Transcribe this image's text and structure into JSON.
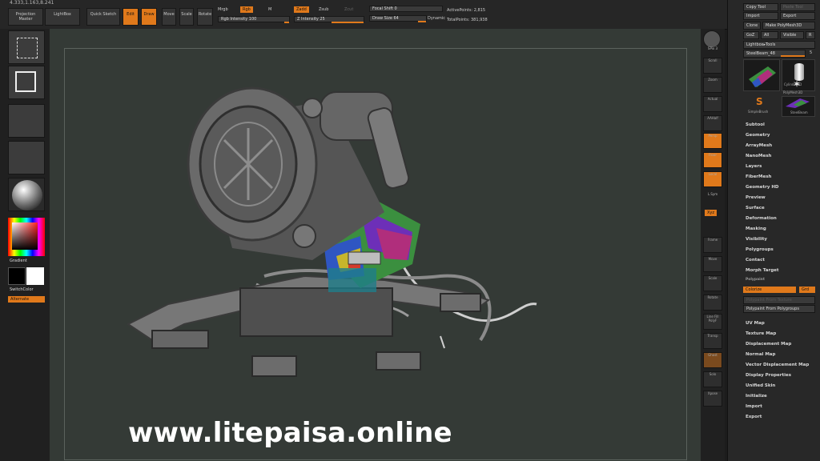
{
  "toolbar": {
    "coords": "4.333,1.163,8.241",
    "projection_master": "Projection Master",
    "lightbox": "LightBox",
    "quick_sketch": "Quick Sketch",
    "edit": "Edit",
    "draw": "Draw",
    "move": "Move",
    "scale": "Scale",
    "rotate": "Rotate",
    "mrgb": "Mrgb",
    "rgb": "Rgb",
    "m": "M",
    "zadd": "Zadd",
    "zsub": "Zsub",
    "zcut": "Zcut",
    "rgb_intensity": "Rgb Intensity 100",
    "z_intensity": "Z Intensity 25",
    "focal_shift": "Focal Shift 0",
    "draw_size": "Draw Size 64",
    "dynamic": "Dynamic",
    "active_points": "ActivePoints: 2,815",
    "total_points": "TotalPoints: 381,938"
  },
  "left_shelf": {
    "gradient": "Gradient",
    "switch_color": "SwitchColor",
    "alternate": "Alternate"
  },
  "right_shelf": {
    "buttons": [
      "BPR",
      "SPix 3",
      "Scroll",
      "Zoom",
      "Actual",
      "AAHalf",
      "Persp",
      "Floor",
      "Local",
      "L.Sym",
      "Frame",
      "Move",
      "Scale",
      "Rotate",
      "Line Fill PolyF",
      "Transp",
      "Ghost",
      "Solo",
      "Xpose"
    ],
    "xyz": "Xyz"
  },
  "tool_panel": {
    "copy_tool": "Copy Tool",
    "paste_tool": "Paste Tool",
    "import": "Import",
    "export": "Export",
    "clone": "Clone",
    "make_polymesh": "Make PolyMesh3D",
    "goz": "GoZ",
    "all": "All",
    "visible": "Visible",
    "r": "R",
    "lightbox_tools": "Lightbox▸Tools",
    "steel_beam": "SteelBeam_48",
    "steel_beam_value": "5",
    "tools": [
      "Cylinder3D",
      "PolyMesh3D",
      "SimpleBrush",
      "SteelBeam"
    ],
    "menu": [
      "Subtool",
      "Geometry",
      "ArrayMesh",
      "NanoMesh",
      "Layers",
      "FiberMesh",
      "Geometry HD",
      "Preview",
      "Surface",
      "Deformation",
      "Masking",
      "Visibility",
      "Polygroups",
      "Contact",
      "Morph Target",
      "Polypaint"
    ],
    "colorize": "Colorize",
    "grd": "Grd",
    "polypaint_from_texture": "Polypaint From Texture",
    "polypaint_from_polygroups": "Polypaint From Polygroups",
    "menu2": [
      "UV Map",
      "Texture Map",
      "Displacement Map",
      "Normal Map",
      "Vector Displacement Map",
      "Display Properties",
      "Unified Skin",
      "Initialize",
      "Import",
      "Export"
    ]
  },
  "watermark": "www.litepaisa.online",
  "colors": {
    "accent": "#e0791b",
    "canvas": "#343a36",
    "panel": "#282828"
  }
}
